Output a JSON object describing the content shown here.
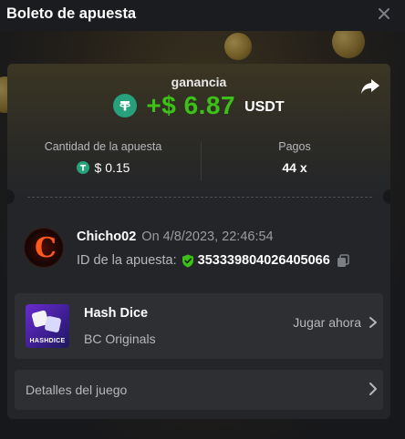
{
  "modal": {
    "title": "Boleto de apuesta"
  },
  "result": {
    "gain_label": "ganancia",
    "gain_value": "+$ 6.87",
    "currency": "USDT"
  },
  "stats": {
    "bet_amount_label": "Cantidad de la apuesta",
    "bet_amount_value": "$ 0.15",
    "payout_label": "Pagos",
    "payout_value": "44 x"
  },
  "bet": {
    "username": "Chicho02",
    "timestamp": "On 4/8/2023, 22:46:54",
    "id_label": "ID de la apuesta:",
    "id_value": "353339804026405066"
  },
  "game": {
    "name": "Hash Dice",
    "provider": "BC Originals",
    "play_label": "Jugar ahora",
    "thumb_text": "HASHDICE"
  },
  "details": {
    "label": "Detalles del juego"
  },
  "colors": {
    "gain": "#3bc117",
    "tether": "#26a17b",
    "background": "#17181b",
    "card": "#232529",
    "panel": "#2d2f33"
  },
  "icons": [
    "close-icon",
    "share-icon",
    "tether-icon",
    "shield-check-icon",
    "copy-icon",
    "chevron-right-icon"
  ]
}
